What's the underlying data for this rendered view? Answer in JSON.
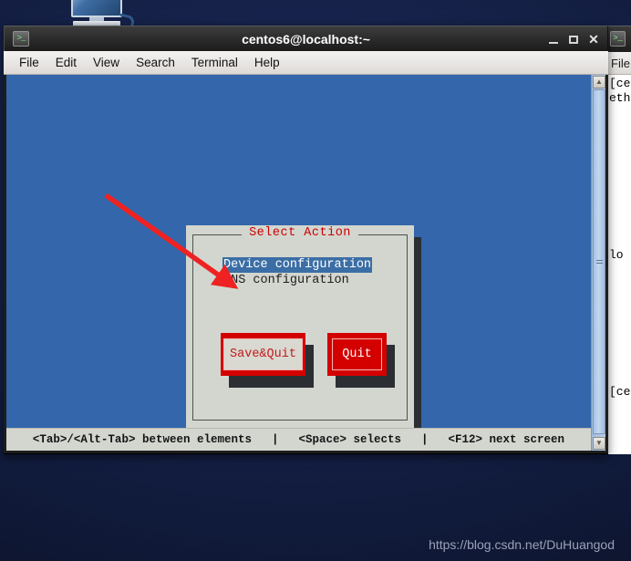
{
  "desktop": {
    "icon_name": "computer-desktop-icon"
  },
  "watermark": "https://blog.csdn.net/DuHuangod",
  "terminal_window": {
    "title": "centos6@localhost:~",
    "icon": "terminal-icon",
    "window_controls": {
      "minimize": "–",
      "maximize": "□",
      "close": "✕"
    },
    "menu": [
      "File",
      "Edit",
      "View",
      "Search",
      "Terminal",
      "Help"
    ],
    "scrollbar": {
      "up_arrow": "▲",
      "down_arrow": "▼"
    }
  },
  "dialog": {
    "title": "Select Action",
    "items": [
      {
        "label": "Device configuration",
        "selected": true
      },
      {
        "label": "DNS configuration",
        "selected": false
      }
    ],
    "buttons": [
      {
        "label": "Save&Quit",
        "focused": true
      },
      {
        "label": "Quit",
        "focused": false
      }
    ]
  },
  "hints": [
    "<Tab>/<Alt-Tab> between elements",
    "<Space> selects",
    "<F12> next screen"
  ],
  "hint_separator": "|",
  "right_window": {
    "icon": "terminal-icon",
    "menu_label": "File",
    "lines": [
      "[ce",
      "eth",
      "lo",
      "[ce"
    ]
  },
  "colors": {
    "terminal_blue": "#3366aa",
    "dialog_bg": "#d3d6cf",
    "dialog_title_red": "#cc0000",
    "button_red": "#d40000",
    "selection_blue": "#3a6ea5",
    "annotation_red": "#ee2222"
  }
}
